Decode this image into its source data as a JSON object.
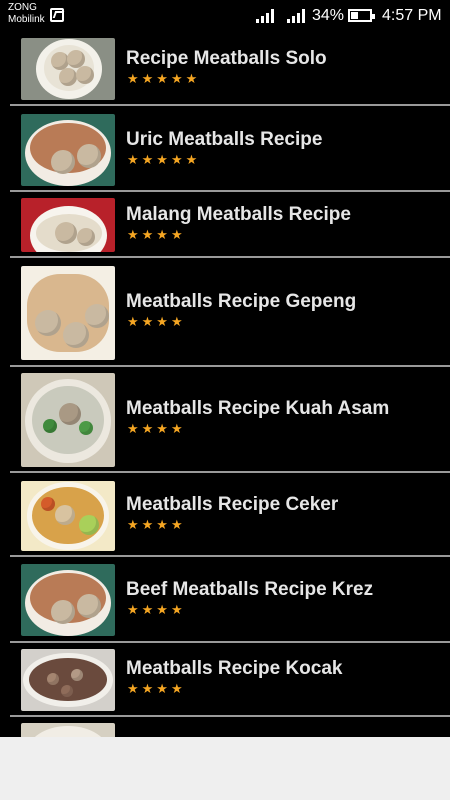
{
  "status_bar": {
    "carrier_line1": "ZONG",
    "carrier_line2": "Mobilink",
    "battery_percent": "34%",
    "time": "4:57 PM"
  },
  "recipes": [
    {
      "title": "Recipe Meatballs Solo",
      "stars": "★★★★★",
      "rating": 5
    },
    {
      "title": "Uric Meatballs Recipe",
      "stars": "★★★★★",
      "rating": 5
    },
    {
      "title": "Malang Meatballs Recipe",
      "stars": "★★★★",
      "rating": 4
    },
    {
      "title": "Meatballs Recipe Gepeng",
      "stars": "★★★★",
      "rating": 4
    },
    {
      "title": "Meatballs Recipe Kuah Asam",
      "stars": "★★★★",
      "rating": 4
    },
    {
      "title": "Meatballs Recipe Ceker",
      "stars": "★★★★",
      "rating": 4
    },
    {
      "title": "Beef Meatballs Recipe Krez",
      "stars": "★★★★",
      "rating": 4
    },
    {
      "title": "Meatballs Recipe Kocak",
      "stars": "★★★★",
      "rating": 4
    }
  ],
  "colors": {
    "background": "#000000",
    "star": "#f5a623",
    "divider": "#9a9a9a",
    "title_text": "#e6e6e6"
  }
}
